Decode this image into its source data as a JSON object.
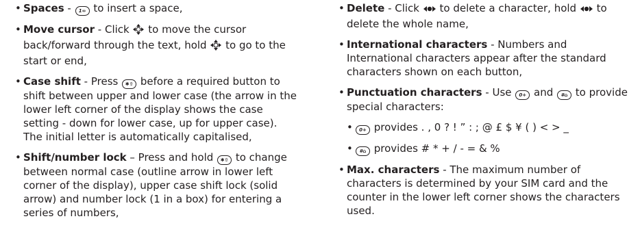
{
  "left": {
    "spaces": {
      "term": "Spaces",
      "sep": " - ",
      "key": "1∞",
      "text": " to insert a space,"
    },
    "move_cursor": {
      "term": "Move cursor",
      "sep": " - Click ",
      "mid": " to move the cursor back/forward through the text, hold ",
      "end": " to go to the start or end,"
    },
    "case_shift": {
      "term": "Case shift",
      "sep": " - Press ",
      "key": "✱⇧",
      "text": " before a required button to shift between upper and lower case (the arrow in the lower left corner of the display shows the case setting - down for lower case, up for upper case). The initial letter is automatically capitalised,"
    },
    "shift_lock": {
      "term": "Shift/number lock",
      "sep": " – Press and hold ",
      "key": "✱⇧",
      "text": " to change between normal case (outline arrow in lower left corner of the display), upper case shift lock (solid arrow) and number lock (1 in a box) for entering a series of numbers,"
    }
  },
  "right": {
    "delete": {
      "term": "Delete",
      "sep": " - Click ",
      "mid": " to delete a character, hold ",
      "end": " to delete the whole name,"
    },
    "international": {
      "term": "International characters",
      "text": " - Numbers and International characters appear after the standard characters shown on each button,"
    },
    "punctuation": {
      "term": "Punctuation characters",
      "sep": " - Use ",
      "key1": "0+",
      "and": " and ",
      "key2": "#⌂",
      "text": " to provide special characters:",
      "sub1_text": " provides . , 0 ? ! ” : ; @ £ $ ¥ ( ) < > _",
      "sub2_text": " provides # * + / - = & %"
    },
    "max": {
      "term": "Max. characters",
      "text": " - The maximum number of characters is determined by your SIM card and the counter in the lower left corner shows the characters used."
    }
  }
}
